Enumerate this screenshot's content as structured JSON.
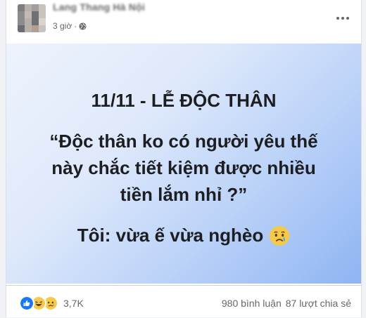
{
  "post": {
    "author": "Lang Thang Hà Nội",
    "time": "3 giờ",
    "separator": "·",
    "privacy_icon": "globe-icon"
  },
  "image_text": {
    "title": "11/11 - LỄ ĐỘC THÂN",
    "quote_line1": "“Độc thân ko có người yêu thế",
    "quote_line2": "này chắc tiết kiệm được nhiều",
    "quote_line3": "tiền lắm nhỉ ?”",
    "answer": "Tôi: vừa ế vừa nghèo",
    "answer_emoji": "crying-face-icon"
  },
  "footer": {
    "reaction_icons": [
      "like-icon",
      "haha-icon",
      "sad-icon"
    ],
    "reaction_count": "3,7K",
    "comments": "980 bình luận",
    "shares": "87 lượt chia sẻ"
  },
  "colors": {
    "like": "#1877f2",
    "emoji_yellow": "#f7c948",
    "text_secondary": "#65676b"
  }
}
